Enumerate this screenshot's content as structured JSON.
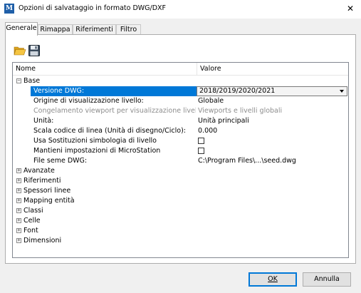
{
  "window": {
    "title": "Opzioni di salvataggio in formato DWG/DXF",
    "close_glyph": "✕",
    "app_icon": "microstation-icon",
    "app_icon_glyph": "M"
  },
  "tabs": [
    {
      "label": "Generale",
      "active": true
    },
    {
      "label": "Rimappa",
      "active": false
    },
    {
      "label": "Riferimenti",
      "active": false
    },
    {
      "label": "Filtro",
      "active": false
    }
  ],
  "toolbar": {
    "open_icon": "folder-open-icon",
    "save_icon": "floppy-save-icon"
  },
  "grid": {
    "header_name": "Nome",
    "header_value": "Valore",
    "sections": [
      {
        "label": "Base",
        "expanded": true,
        "expander_glyph": "−",
        "properties": [
          {
            "name": "Versione DWG:",
            "value": "2018/2019/2020/2021",
            "kind": "combo",
            "selected": true
          },
          {
            "name": "Origine di visualizzazione livello:",
            "value": "Globale",
            "kind": "text"
          },
          {
            "name": "Congelamento viewport per visualizzazione livello ...",
            "value": "Viewports e livelli globali",
            "kind": "text",
            "disabled": true
          },
          {
            "name": "Unità:",
            "value": "Unità principali",
            "kind": "text"
          },
          {
            "name": "Scala codice di linea (Unità di disegno/Ciclo):",
            "value": "0.000",
            "kind": "text"
          },
          {
            "name": "Usa Sostituzioni simbologia di livello",
            "value": "",
            "kind": "checkbox",
            "checked": false
          },
          {
            "name": "Mantieni impostazioni di MicroStation",
            "value": "",
            "kind": "checkbox",
            "checked": false
          },
          {
            "name": "File seme DWG:",
            "value": "C:\\Program Files\\...\\seed.dwg",
            "kind": "text"
          }
        ]
      },
      {
        "label": "Avanzate",
        "expanded": false,
        "expander_glyph": "+"
      },
      {
        "label": "Riferimenti",
        "expanded": false,
        "expander_glyph": "+"
      },
      {
        "label": "Spessori linee",
        "expanded": false,
        "expander_glyph": "+"
      },
      {
        "label": "Mapping entità",
        "expanded": false,
        "expander_glyph": "+"
      },
      {
        "label": "Classi",
        "expanded": false,
        "expander_glyph": "+"
      },
      {
        "label": "Celle",
        "expanded": false,
        "expander_glyph": "+"
      },
      {
        "label": "Font",
        "expanded": false,
        "expander_glyph": "+"
      },
      {
        "label": "Dimensioni",
        "expanded": false,
        "expander_glyph": "+"
      }
    ]
  },
  "buttons": {
    "ok_label": "OK",
    "cancel_label": "Annulla"
  },
  "colors": {
    "selection": "#0078d7",
    "default_button_border": "#0078d7",
    "disabled_text": "#8d8d8d"
  }
}
